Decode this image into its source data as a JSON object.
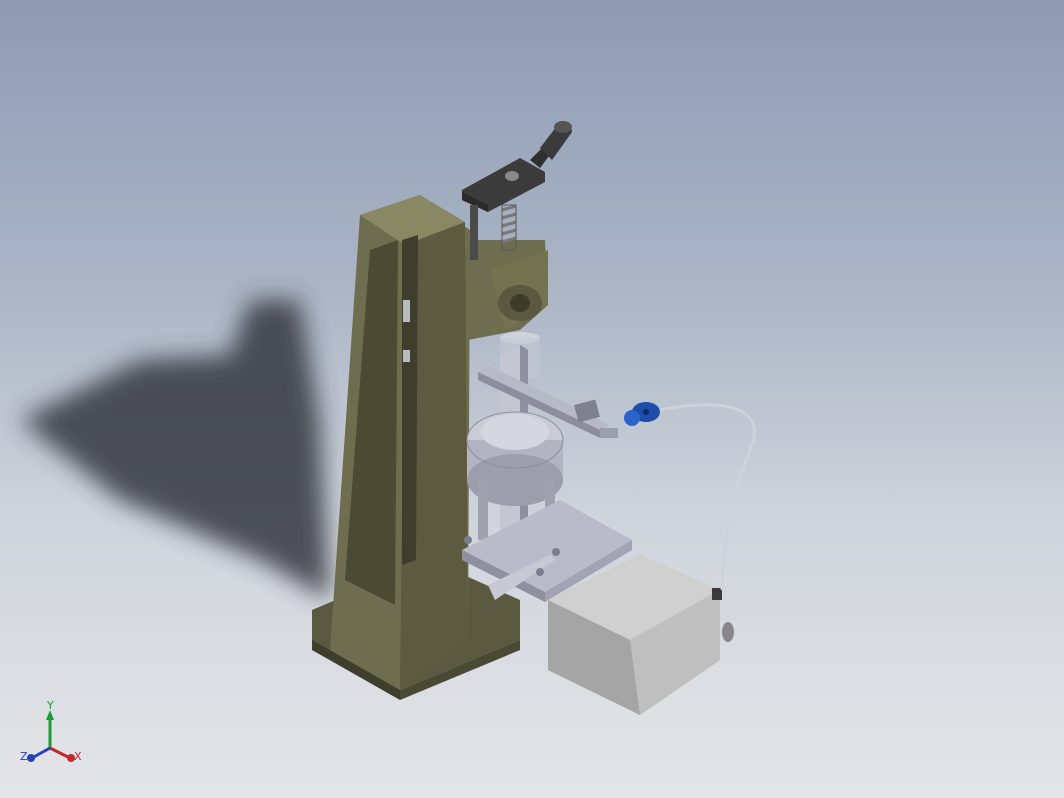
{
  "viewport": {
    "colors": {
      "frame": "#6f6d4f",
      "frame_dark": "#4b4a33",
      "frame_light": "#8a8862",
      "steel": "#b8bac8",
      "steel_dark": "#7b7d8c",
      "housing": "#b7b7b7",
      "handle": "#3a3a3a",
      "knob_blue": "#1d4fa8",
      "cable": "#cfd2d8"
    }
  },
  "triad": {
    "x_label": "X",
    "y_label": "Y",
    "z_label": "Z",
    "x_color": "#c0282d",
    "y_color": "#1f9a3a",
    "z_color": "#2540b8"
  }
}
